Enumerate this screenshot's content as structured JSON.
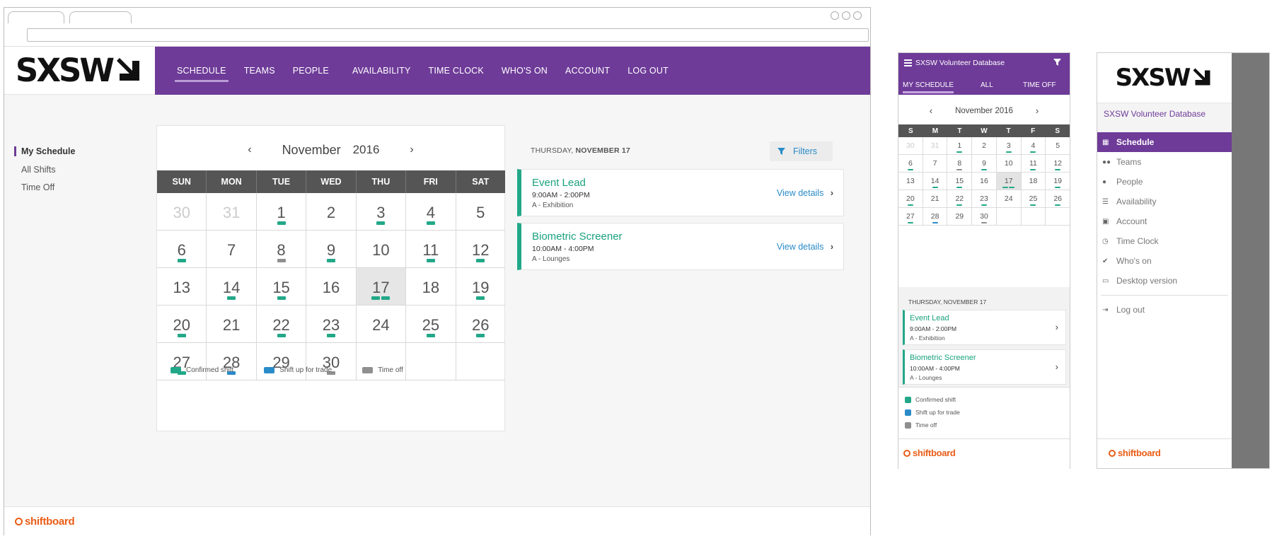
{
  "brand": {
    "logo_text": "SXSW",
    "shiftboard": "shiftboard"
  },
  "desktop": {
    "nav": [
      "SCHEDULE",
      "TEAMS",
      "PEOPLE",
      "AVAILABILITY",
      "TIME CLOCK",
      "WHO'S ON",
      "ACCOUNT",
      "LOG OUT"
    ],
    "sidebar": [
      "My Schedule",
      "All Shifts",
      "Time Off"
    ],
    "calendar": {
      "month": "November",
      "year": "2016",
      "prev": "‹",
      "next": "›",
      "days": [
        "SUN",
        "MON",
        "TUE",
        "WED",
        "THU",
        "FRI",
        "SAT"
      ],
      "weeks": [
        [
          {
            "d": "30",
            "m": true
          },
          {
            "d": "31",
            "m": true
          },
          {
            "d": "1",
            "b": [
              "g"
            ]
          },
          {
            "d": "2"
          },
          {
            "d": "3",
            "b": [
              "g"
            ]
          },
          {
            "d": "4",
            "b": [
              "g"
            ]
          },
          {
            "d": "5"
          }
        ],
        [
          {
            "d": "6",
            "b": [
              "g"
            ]
          },
          {
            "d": "7"
          },
          {
            "d": "8",
            "b": [
              "x"
            ]
          },
          {
            "d": "9",
            "b": [
              "g"
            ]
          },
          {
            "d": "10"
          },
          {
            "d": "11",
            "b": [
              "g"
            ]
          },
          {
            "d": "12",
            "b": [
              "g"
            ]
          }
        ],
        [
          {
            "d": "13"
          },
          {
            "d": "14",
            "b": [
              "g"
            ]
          },
          {
            "d": "15",
            "b": [
              "g"
            ]
          },
          {
            "d": "16"
          },
          {
            "d": "17",
            "t": true,
            "b": [
              "g",
              "g"
            ]
          },
          {
            "d": "18"
          },
          {
            "d": "19",
            "b": [
              "g"
            ]
          }
        ],
        [
          {
            "d": "20",
            "b": [
              "g"
            ]
          },
          {
            "d": "21"
          },
          {
            "d": "22",
            "b": [
              "g"
            ]
          },
          {
            "d": "23",
            "b": [
              "g"
            ]
          },
          {
            "d": "24"
          },
          {
            "d": "25",
            "b": [
              "g"
            ]
          },
          {
            "d": "26",
            "b": [
              "g"
            ]
          }
        ],
        [
          {
            "d": "27",
            "b": [
              "g"
            ]
          },
          {
            "d": "28",
            "b": [
              "b"
            ]
          },
          {
            "d": "29"
          },
          {
            "d": "30",
            "b": [
              "x"
            ]
          },
          {
            "d": ""
          },
          {
            "d": ""
          },
          {
            "d": ""
          }
        ]
      ]
    },
    "legend": [
      "Confirmed shift",
      "Shift up for trade",
      "Time off"
    ],
    "day_label_light": "THURSDAY, ",
    "day_label_bold": "NOVEMBER 17",
    "filters": "Filters",
    "view_details": "View details"
  },
  "shifts": [
    {
      "name": "Event Lead",
      "time": "9:00AM - 2:00PM",
      "location": "A - Exhibition"
    },
    {
      "name": "Biometric Screener",
      "time": "10:00AM - 4:00PM",
      "location": "A - Lounges"
    }
  ],
  "mobile": {
    "app_title": "SXSW Volunteer Database",
    "tabs": [
      "MY SCHEDULE",
      "ALL",
      "TIME OFF"
    ],
    "month_year": "November 2016",
    "days": [
      "S",
      "M",
      "T",
      "W",
      "T",
      "F",
      "S"
    ],
    "day_label": "THURSDAY, NOVEMBER 17"
  },
  "menu": {
    "title": "SXSW Volunteer Database",
    "items": [
      "Schedule",
      "Teams",
      "People",
      "Availability",
      "Account",
      "Time Clock",
      "Who's on",
      "Desktop version"
    ],
    "logout": "Log out"
  },
  "colors": {
    "purple": "#6e3b98",
    "green": "#22a889",
    "blue": "#2a8bc9",
    "gray": "#8f8f8f",
    "orange": "#e95d17"
  }
}
